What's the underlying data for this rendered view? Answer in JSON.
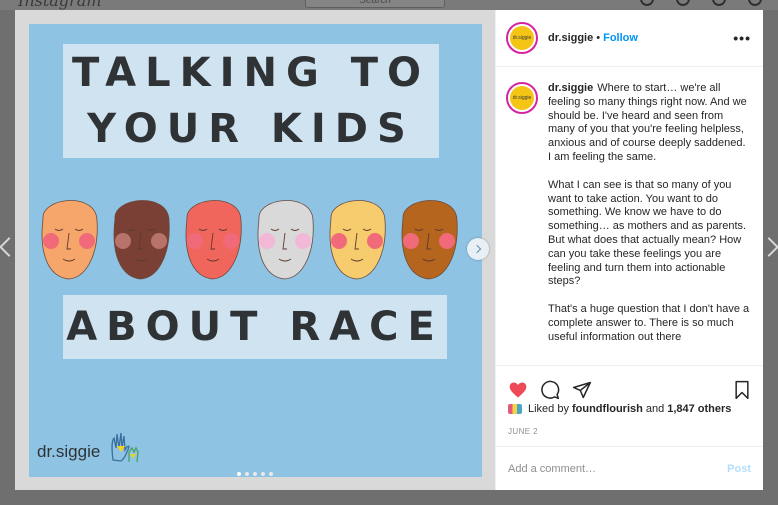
{
  "background": {
    "logo_text": "Instagram",
    "search_placeholder": "Search"
  },
  "slide": {
    "title_top": "TALKING TO YOUR KIDS",
    "title_bottom": "ABOUT RACE",
    "brand_text": "dr.siggie",
    "face_colors": [
      "#f7a66b",
      "#7a4035",
      "#f0655c",
      "#d9d9d9",
      "#f7cc6e",
      "#b5651d"
    ],
    "slide_count": 5,
    "active_slide": 1
  },
  "post": {
    "username": "dr.siggie",
    "separator": "•",
    "follow_label": "Follow",
    "more_label": "•••",
    "caption_paragraphs": [
      "Where to start… we're all feeling so many things right now. And we should be. I've heard and seen from many of you that you're feeling helpless, anxious and of course deeply saddened. I am feeling the same.",
      "What I can see is that so many of you want to take action. You want to do something. We know we have to do something… as mothers and as parents. But what does that actually mean? How can you take these feelings you are feeling and turn them into actionable steps?",
      "That's a huge question that I don't have a complete answer to. There is so much useful information out there"
    ],
    "liked_by_prefix": "Liked by",
    "liked_by_user": "foundflourish",
    "liked_by_and": "and",
    "likes_count": "1,847 others",
    "date": "JUNE 2",
    "comment_placeholder": "Add a comment…",
    "post_label": "Post",
    "avatar_text": "dr.siggie"
  },
  "colors": {
    "accent": "#0095f6",
    "like": "#ed4956",
    "slide_bg": "#8ec3e4"
  }
}
